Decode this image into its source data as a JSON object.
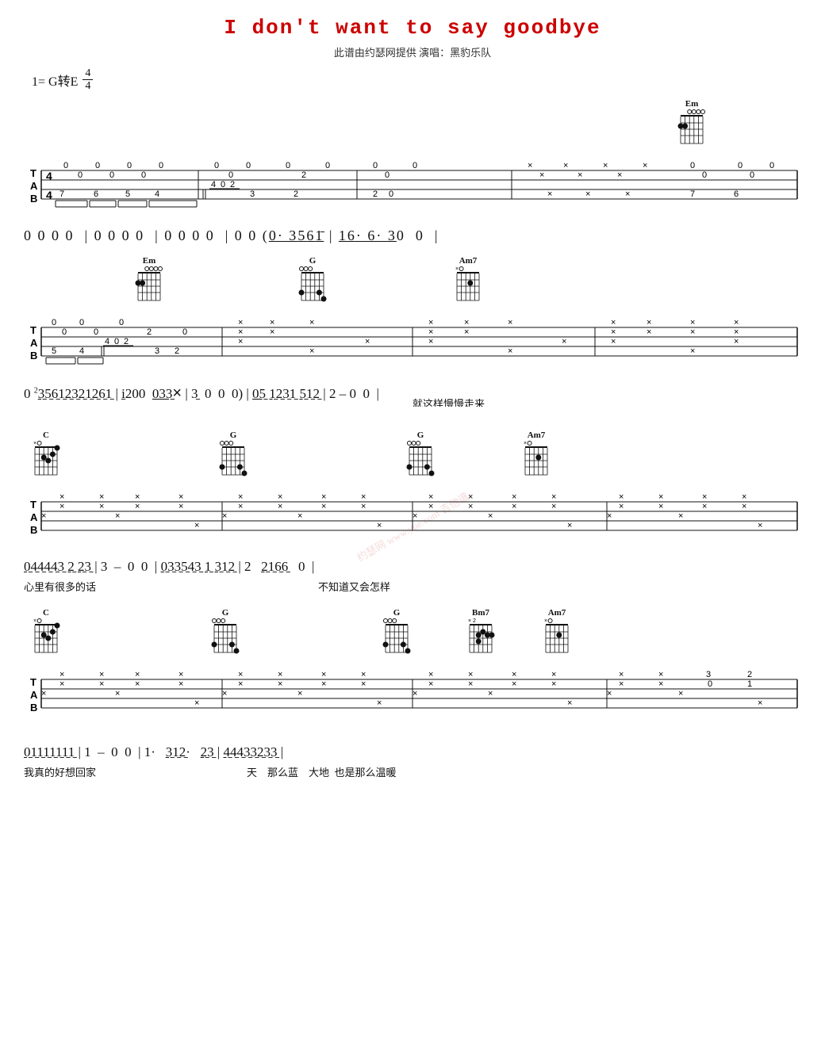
{
  "title": "I don't want to say goodbye",
  "subtitle": "此谱由约瑟网提供   演唱：黑豹乐队",
  "key": "1= G转E",
  "time_sig": {
    "top": "4",
    "bottom": "4"
  },
  "sections": [
    {
      "id": "s1",
      "chords_pos": "right",
      "chords": [
        {
          "name": "Em",
          "pos": "right"
        }
      ],
      "notation": "0 0 0 0 | 0 0 0 0 | 0 0 0 0 | 0 0 (0· 356̣1̄ | 16· 6· 30 0 |",
      "lyrics": ""
    },
    {
      "id": "s2",
      "chords": [
        {
          "name": "Em",
          "x": 1
        },
        {
          "name": "G",
          "x": 2
        },
        {
          "name": "Am7",
          "x": 3
        }
      ],
      "notation": "0 ²3̱5̱6̱1̱2̱3̱2̱1̱2̱6̱1̱ | i̱200  033̱× | 3̱  0  0  0) | 05̱ 1̱2̱3̱1̱ 5̱1̱2̱ | 2 - 0  0 |",
      "lyrics": "                                                就这样慢慢走来"
    },
    {
      "id": "s3",
      "chords": [
        {
          "name": "C"
        },
        {
          "name": "G"
        },
        {
          "name": "G"
        },
        {
          "name": "Am7"
        }
      ],
      "notation": "0̱4̱4̱4̱4̱3̱ 2̱ 2̱3̱ | 3  -  0  0  | 0̱3̱3̱5̱4̱3̱ 1̱ 3̱1̱2̱ | 2   2̱1̱6̱6̱   0 |",
      "lyrics": "心里有很多的话                    不知道又会怎样"
    },
    {
      "id": "s4",
      "chords": [
        {
          "name": "C"
        },
        {
          "name": "G"
        },
        {
          "name": "G"
        },
        {
          "name": "Bm7"
        },
        {
          "name": "Am7"
        }
      ],
      "notation": "0̱1̱1̱1̱1̱1̱1̱1̱ | 1  -  0  0  | 1·   3̱1̱2̱·   2̱3̱ | 4̱4̱4̱3̱3̱2̱3̱3̱ |",
      "lyrics": "我真的好想回家              天    那么蓝    大地  也是那么温暖"
    }
  ],
  "colors": {
    "title": "#cc0000",
    "watermark": "rgba(180,0,0,0.2)"
  }
}
